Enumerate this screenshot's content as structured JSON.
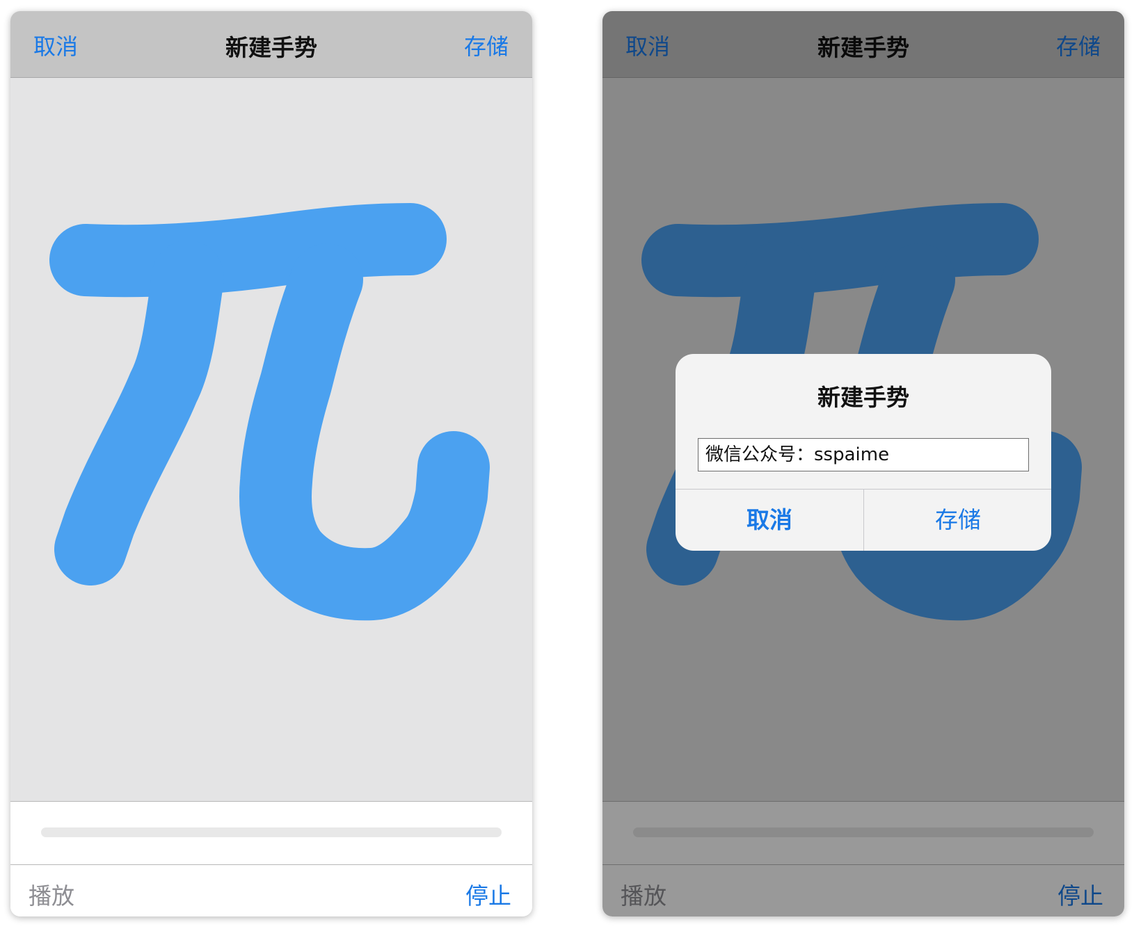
{
  "colors": {
    "accent": "#1a79e6",
    "gesture_stroke": "#4ba1f0",
    "navbar_bg": "#c4c4c4",
    "canvas_bg": "#e4e4e5",
    "dim_overlay": "rgba(0,0,0,0.4)"
  },
  "left_screen": {
    "navbar": {
      "cancel": "取消",
      "title": "新建手势",
      "save": "存储"
    },
    "toolbar": {
      "play": "播放",
      "stop": "停止"
    },
    "progress": {
      "value": 0
    }
  },
  "right_screen": {
    "navbar": {
      "cancel": "取消",
      "title": "新建手势",
      "save": "存储"
    },
    "toolbar": {
      "play": "播放",
      "stop": "停止"
    },
    "progress": {
      "value": 0
    },
    "alert": {
      "title": "新建手势",
      "input_value": "微信公众号：sspaime",
      "cancel": "取消",
      "save": "存储"
    }
  }
}
